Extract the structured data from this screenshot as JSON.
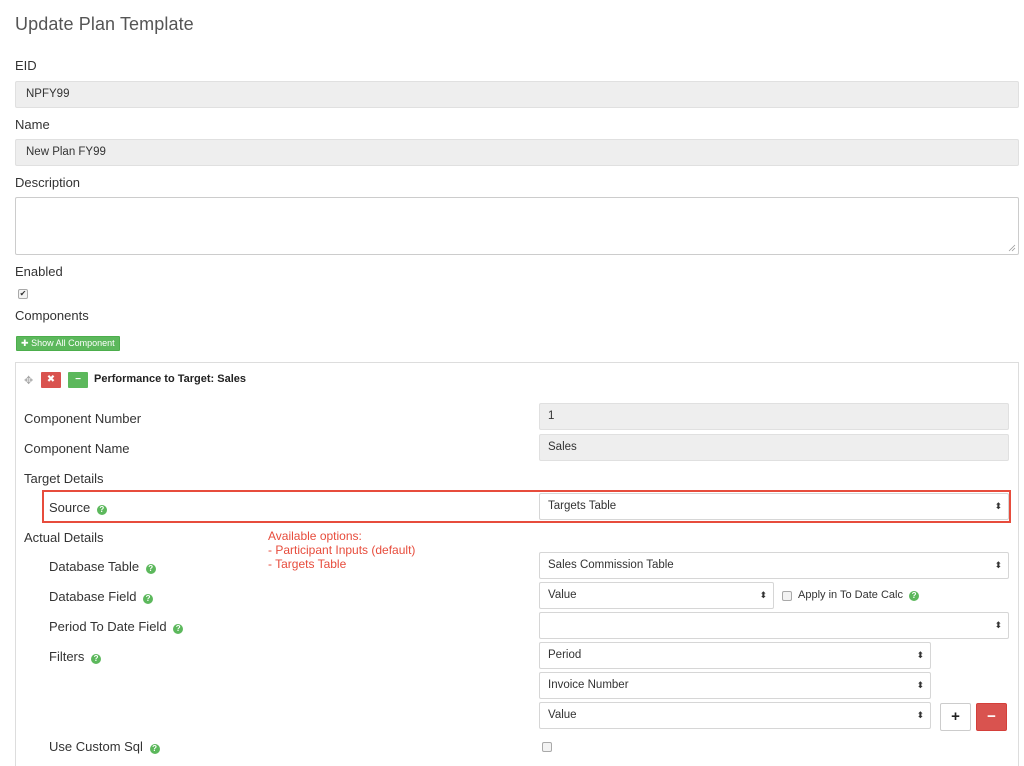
{
  "page": {
    "title": "Update Plan Template"
  },
  "form": {
    "eid_label": "EID",
    "eid_value": "NPFY99",
    "name_label": "Name",
    "name_value": "New Plan FY99",
    "description_label": "Description",
    "description_value": "",
    "enabled_label": "Enabled",
    "enabled_checked": true,
    "components_label": "Components",
    "show_all_label": "Show All Component"
  },
  "component": {
    "title": "Performance to Target: Sales",
    "number_label": "Component Number",
    "number_value": "1",
    "name_label": "Component Name",
    "name_value": "Sales",
    "target_details_label": "Target Details",
    "source_label": "Source",
    "source_value": "Targets Table",
    "actual_details_label": "Actual Details",
    "database_table_label": "Database Table",
    "database_table_value": "Sales Commission Table",
    "database_field_label": "Database Field",
    "database_field_value": "Value",
    "apply_to_date_label": "Apply in To Date Calc",
    "period_to_date_label": "Period To Date Field",
    "period_to_date_value": "",
    "filters_label": "Filters",
    "filters": [
      "Period",
      "Invoice Number",
      "Value"
    ],
    "use_custom_sql_label": "Use Custom Sql"
  },
  "annotation": {
    "line1": "Available options:",
    "line2": "- Participant Inputs (default)",
    "line3": "- Targets Table"
  },
  "colors": {
    "accent_green": "#5cb85c",
    "danger_red": "#d9534f",
    "annotation_red": "#e74c3c"
  }
}
